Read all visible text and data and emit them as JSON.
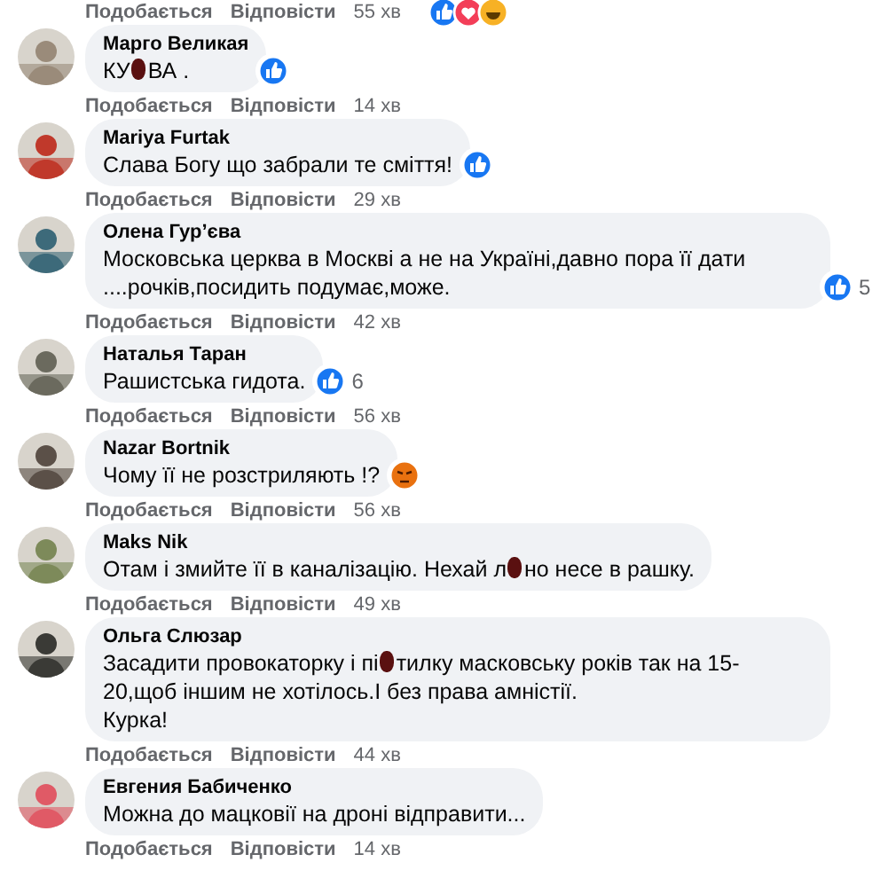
{
  "top_actions": {
    "like": "Подобається",
    "reply": "Відповісти",
    "time": "55 хв",
    "reactions": [
      {
        "kind": "like"
      },
      {
        "kind": "love"
      },
      {
        "kind": "haha"
      }
    ]
  },
  "comments": [
    {
      "author": "Марго Великая",
      "lines": [
        [
          "КУ",
          "ВА ."
        ]
      ],
      "reaction": {
        "kind": "like"
      },
      "like": "Подобається",
      "reply": "Відповісти",
      "time": "14 хв"
    },
    {
      "author": "Mariya Furtak",
      "lines": [
        [
          "Слава Богу що забрали те сміття!"
        ]
      ],
      "reaction": {
        "kind": "like"
      },
      "like": "Подобається",
      "reply": "Відповісти",
      "time": "29 хв"
    },
    {
      "author": "Олена Гурʼєва",
      "lines": [
        [
          "Московська церква в Москві а не на Україні,давно пора її дати ....рочків,посидить подумає,може."
        ]
      ],
      "reaction": {
        "kind": "like",
        "count": "5"
      },
      "like": "Подобається",
      "reply": "Відповісти",
      "time": "42 хв"
    },
    {
      "author": "Наталья Таран",
      "lines": [
        [
          "Рашистська гидота."
        ]
      ],
      "reaction": {
        "kind": "like",
        "count": "6"
      },
      "like": "Подобається",
      "reply": "Відповісти",
      "time": "56 хв"
    },
    {
      "author": "Nazar Bortnik",
      "lines": [
        [
          "Чому її не розстриляють !?"
        ]
      ],
      "reaction": {
        "kind": "angry"
      },
      "like": "Подобається",
      "reply": "Відповісти",
      "time": "56 хв"
    },
    {
      "author": "Maks Nik",
      "lines": [
        [
          "Отам і змийте її в каналізацію. Нехай л",
          "но несе в рашку."
        ]
      ],
      "like": "Подобається",
      "reply": "Відповісти",
      "time": "49 хв"
    },
    {
      "author": "Ольга Слюзар",
      "lines": [
        [
          "Засадити провокаторку і пі",
          "тилку масковську років так на 15-20,щоб іншим не хотілось.І без права амністії."
        ],
        [
          "Курка!"
        ]
      ],
      "like": "Подобається",
      "reply": "Відповісти",
      "time": "44 хв"
    },
    {
      "author": "Евгения Бабиченко",
      "lines": [
        [
          "Можна до мацковії на дроні відправити..."
        ]
      ],
      "like": "Подобається",
      "reply": "Відповісти",
      "time": "14 хв"
    }
  ]
}
